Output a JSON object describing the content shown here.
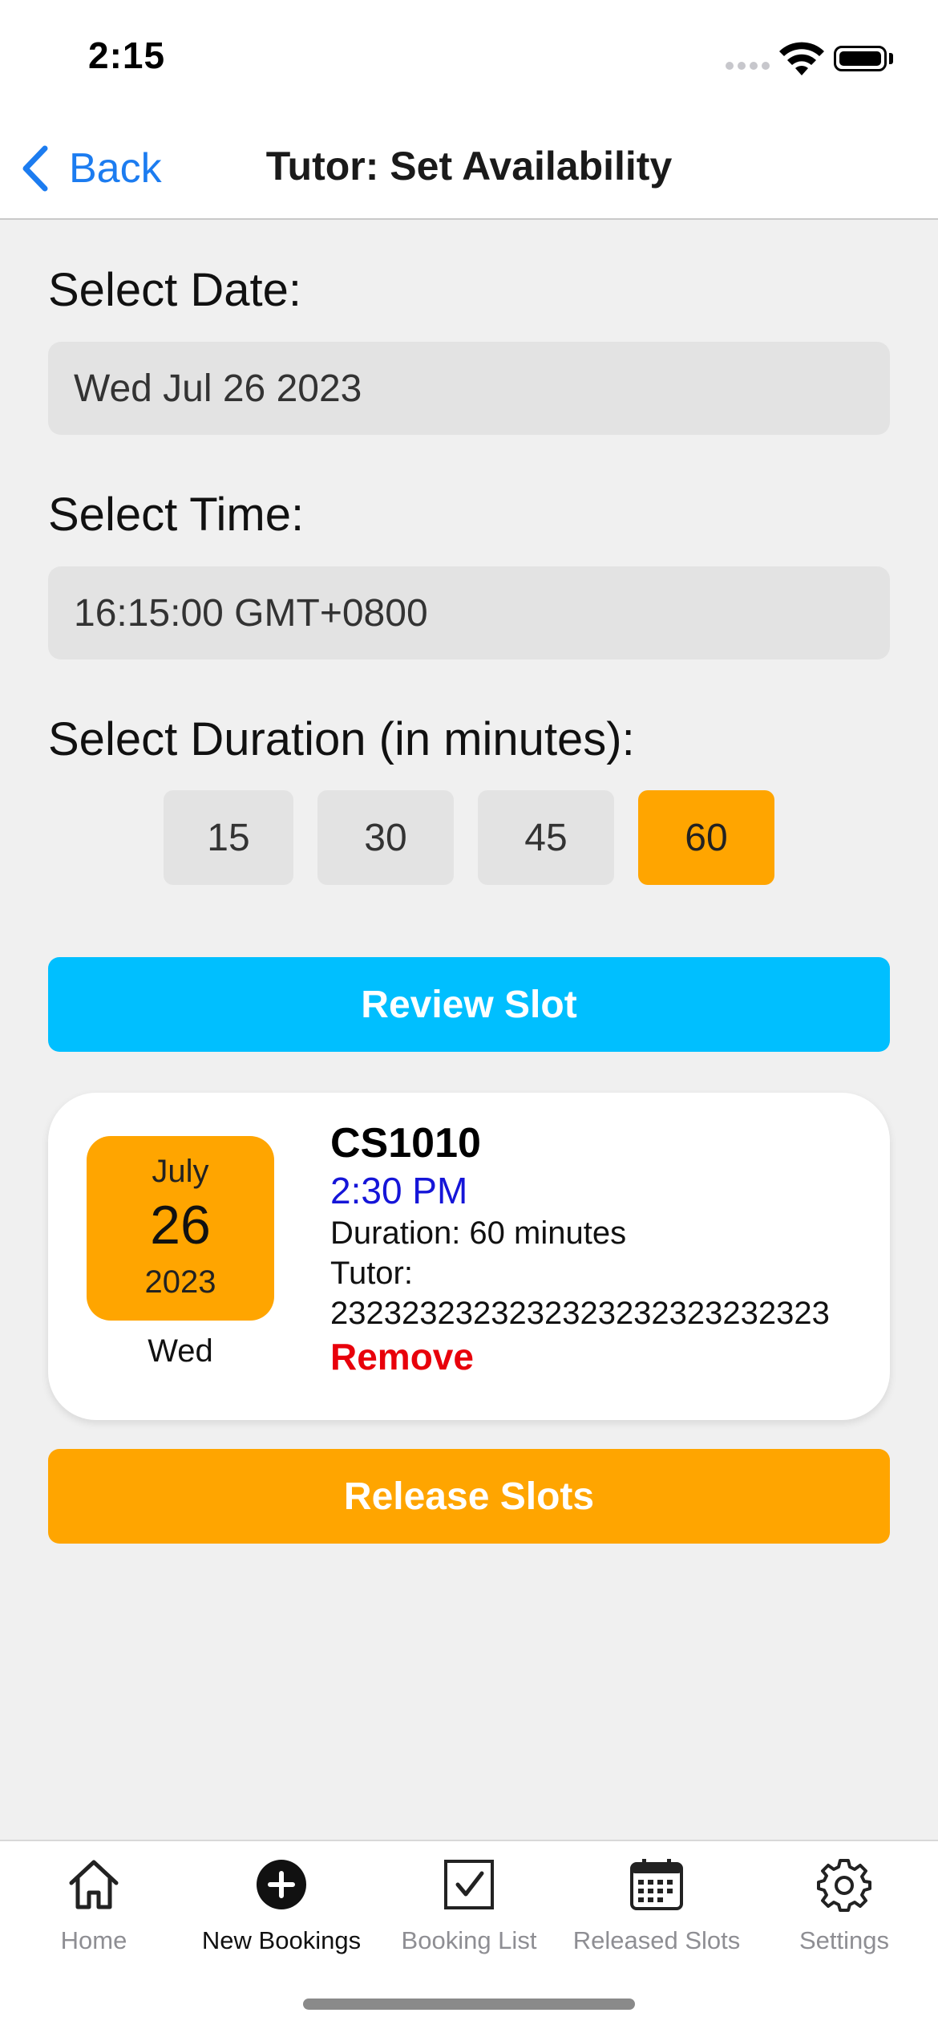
{
  "status_bar": {
    "time": "2:15"
  },
  "nav": {
    "back_label": "Back",
    "title": "Tutor: Set Availability"
  },
  "form": {
    "date_label": "Select Date:",
    "date_value": "Wed Jul 26 2023",
    "time_label": "Select Time:",
    "time_value": "16:15:00 GMT+0800",
    "duration_label": "Select Duration (in minutes):",
    "durations": [
      "15",
      "30",
      "45",
      "60"
    ],
    "selected_duration": "60"
  },
  "review_button": "Review Slot",
  "slot_card": {
    "month": "July",
    "day": "26",
    "year": "2023",
    "weekday": "Wed",
    "course": "CS1010",
    "time": "2:30 PM",
    "duration": "Duration: 60 minutes",
    "tutor_label": "Tutor:",
    "tutor_id": "2323232323232323232323232323",
    "remove_label": "Remove"
  },
  "release_button": "Release Slots",
  "tabs": [
    {
      "label": "Home",
      "icon": "home-icon"
    },
    {
      "label": "New Bookings",
      "icon": "plus-circle-icon"
    },
    {
      "label": "Booking List",
      "icon": "checkbox-icon"
    },
    {
      "label": "Released Slots",
      "icon": "calendar-icon"
    },
    {
      "label": "Settings",
      "icon": "gear-icon"
    }
  ],
  "active_tab": "New Bookings",
  "colors": {
    "accent_blue": "#1c7cf0",
    "review_button": "#00bfff",
    "orange": "#ffa500",
    "remove_red": "#e8000b",
    "time_blue": "#1515d8"
  }
}
